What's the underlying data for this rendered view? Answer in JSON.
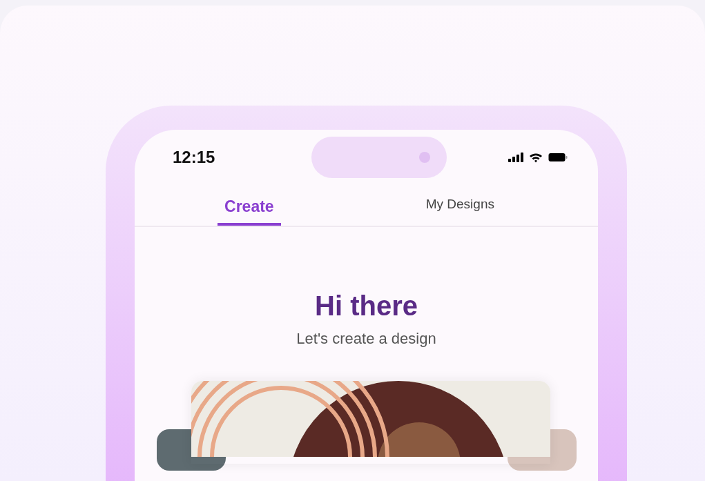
{
  "status_bar": {
    "time": "12:15"
  },
  "tabs": [
    {
      "label": "Create",
      "selected": true
    },
    {
      "label": "My Designs",
      "selected": false
    }
  ],
  "greeting": {
    "title": "Hi there",
    "subtitle": "Let's create a design"
  }
}
